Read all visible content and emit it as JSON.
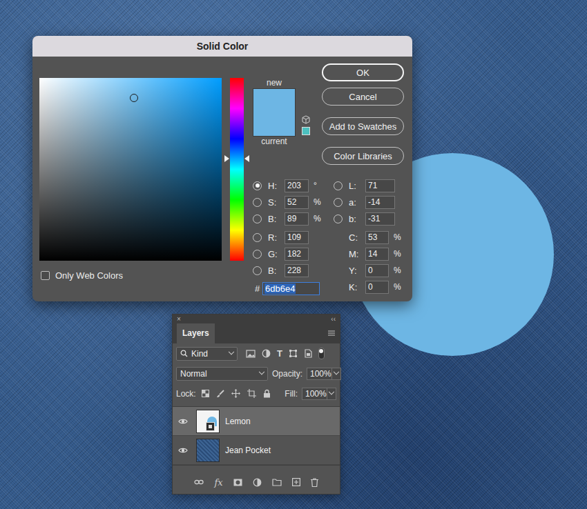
{
  "dialog": {
    "title": "Solid Color",
    "buttons": [
      {
        "label": "OK",
        "default": true
      },
      {
        "label": "Cancel",
        "default": false
      },
      {
        "label": "Add to Swatches",
        "default": false
      },
      {
        "label": "Color Libraries",
        "default": false
      }
    ],
    "picker": {
      "saturation_level": 0.52,
      "brightness_level": 0.89
    },
    "hue_slider": {
      "level": 0.56
    },
    "swatch": {
      "new_label": "new",
      "current_label": "current",
      "new_color": "#6db6e4",
      "current_color": "#6db6e4"
    },
    "fields": {
      "left": [
        [
          {
            "label": "H:",
            "value": "203",
            "unit": "°",
            "kind": "radio",
            "selected": true
          },
          {
            "label": "S:",
            "value": "52",
            "unit": "%",
            "kind": "radio",
            "selected": false
          },
          {
            "label": "B:",
            "value": "89",
            "unit": "%",
            "kind": "radio",
            "selected": false
          }
        ],
        [
          {
            "label": "R:",
            "value": "109",
            "unit": "",
            "kind": "radio",
            "selected": false
          },
          {
            "label": "G:",
            "value": "182",
            "unit": "",
            "kind": "radio",
            "selected": false
          },
          {
            "label": "B:",
            "value": "228",
            "unit": "",
            "kind": "radio",
            "selected": false
          }
        ]
      ],
      "right": [
        [
          {
            "label": "L:",
            "value": "71",
            "unit": "",
            "kind": "radio",
            "selected": false
          },
          {
            "label": "a:",
            "value": "-14",
            "unit": "",
            "kind": "radio",
            "selected": false
          },
          {
            "label": "b:",
            "value": "-31",
            "unit": "",
            "kind": "radio",
            "selected": false
          }
        ],
        [
          {
            "label": "C:",
            "value": "53",
            "unit": "%",
            "kind": "plain",
            "selected": false
          },
          {
            "label": "M:",
            "value": "14",
            "unit": "%",
            "kind": "plain",
            "selected": false
          },
          {
            "label": "Y:",
            "value": "0",
            "unit": "%",
            "kind": "plain",
            "selected": false
          },
          {
            "label": "K:",
            "value": "0",
            "unit": "%",
            "kind": "plain",
            "selected": false
          }
        ]
      ]
    },
    "hex": {
      "label": "#",
      "value": "6db6e4",
      "selected": true
    },
    "only_web_colors": {
      "label": "Only Web Colors",
      "checked": false
    }
  },
  "layers_panel": {
    "close": "×",
    "collapse": "‹‹",
    "tab": "Layers",
    "filter": "Kind",
    "type_filter": "T",
    "filter_toggle": {
      "on": true
    },
    "blend_mode": "Normal",
    "opacity_label": "Opacity:",
    "opacity": "100%",
    "lock_label": "Lock:",
    "fill_label": "Fill:",
    "fill": "100%",
    "layers": [
      {
        "name": "Lemon",
        "selected": true,
        "visible": true,
        "kind": "fill"
      },
      {
        "name": "Jean Pocket",
        "selected": false,
        "visible": true,
        "kind": "image"
      }
    ],
    "fx_label": "fx"
  }
}
